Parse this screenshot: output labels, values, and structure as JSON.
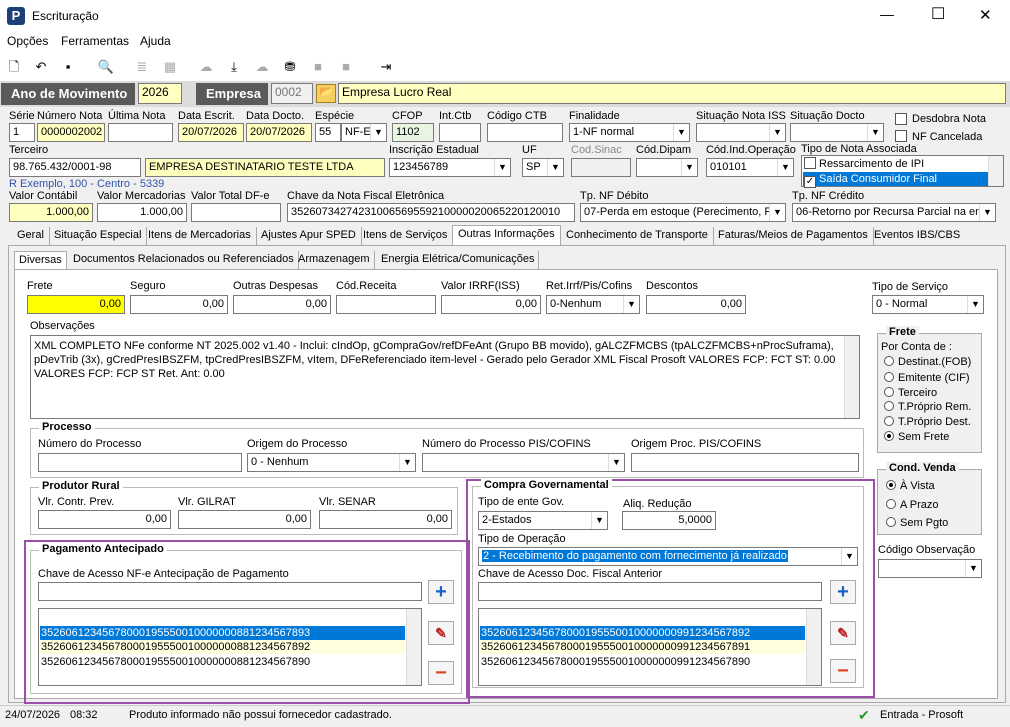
{
  "window": {
    "title": "Escrituração",
    "min": "—",
    "max": "☐",
    "close": "✕"
  },
  "menu": [
    "Opções",
    "Ferramentas",
    "Ajuda"
  ],
  "header": {
    "ano_label": "Ano de Movimento",
    "ano": "2026",
    "empresa_label": "Empresa",
    "empresa_cod": "0002",
    "empresa_nome": "Empresa Lucro Real"
  },
  "doc": {
    "serie_l": "Série",
    "serie": "1",
    "numero_l": "Número Nota",
    "numero": "0000002002",
    "ultima_l": "Última Nota",
    "ultima": "",
    "dtescr_l": "Data Escrit.",
    "dtescr": "20/07/2026",
    "dtdoc_l": "Data Docto.",
    "dtdoc": "20/07/2026",
    "especie_l": "Espécie",
    "especie_n": "55",
    "especie": "NF-E",
    "cfop_l": "CFOP",
    "cfop": "1102",
    "intctb_l": "Int.Ctb",
    "intctb": "",
    "codctb_l": "Código CTB",
    "codctb": "",
    "final_l": "Finalidade",
    "final": "1-NF normal",
    "sitiss_l": "Situação Nota ISS",
    "sitiss": "",
    "sitdoc_l": "Situação Docto",
    "sitdoc": "",
    "desdobra": "Desdobra Nota",
    "cancelada": "NF Cancelada",
    "terc_l": "Terceiro",
    "terc": "98.765.432/0001-98",
    "terc_nome": "EMPRESA DESTINATARIO TESTE LTDA",
    "terc_end": "R Exemplo, 100 - Centro - 5339",
    "ie_l": "Inscrição Estadual",
    "ie": "123456789",
    "uf_l": "UF",
    "uf": "SP",
    "sinac_l": "Cod.Sinac",
    "sinac": "",
    "dipam_l": "Cód.Dipam",
    "dipam": "",
    "indop_l": "Cód.Ind.Operação",
    "indop": "010101",
    "tipoassoc_l": "Tipo de Nota Associada",
    "assoc": [
      "Ressarcimento de IPI",
      "Saída Consumidor Final"
    ],
    "vcont_l": "Valor Contábil",
    "vcont": "1.000,00",
    "vmerc_l": "Valor Mercadorias",
    "vmerc": "1.000,00",
    "vtot_l": "Valor Total DF-e",
    "vtot": "",
    "chave_l": "Chave da Nota Fiscal Eletrônica",
    "chave": "35260734274231006569559210000020065220120010",
    "tpdeb_l": "Tp. NF Débito",
    "tpdeb": "07-Perda em estoque (Perecimento, P",
    "tpcred_l": "Tp. NF Crédito",
    "tpcred": "06-Retorno por Recursa Parcial na en"
  },
  "tabs": [
    "Geral",
    "Situação Especial",
    "Itens de Mercadorias",
    "Ajustes Apur SPED",
    "Itens de Serviços",
    "Outras Informações",
    "Conhecimento de Transporte",
    "Faturas/Meios de Pagamentos",
    "Eventos IBS/CBS"
  ],
  "subtabs": [
    "Diversas",
    "Documentos Relacionados ou Referenciados",
    "Armazenagem",
    "Energia Elétrica/Comunicações"
  ],
  "div": {
    "frete_l": "Frete",
    "frete": "0,00",
    "seguro_l": "Seguro",
    "seguro": "0,00",
    "outras_l": "Outras Despesas",
    "outras": "0,00",
    "codrec_l": "Cód.Receita",
    "codrec": "",
    "irrf_l": "Valor IRRF(ISS)",
    "irrf": "0,00",
    "retirrf_l": "Ret.Irrf/Pis/Cofins",
    "retirrf": "0-Nenhum",
    "desc_l": "Descontos",
    "desc": "0,00",
    "tiposerv_l": "Tipo de Serviço",
    "tiposerv": "0 - Normal",
    "obs_l": "Observações",
    "obs": [
      "XML COMPLETO NFe conforme NT 2025.002 v1.40 - Inclui: cIndOp, gCompraGov/refDFeAnt (Grupo BB movido), gALCZFMCBS (tpALCZFMCBS+nProcSuframa),",
      "pDevTrib (3x), gCredPresIBSZFM, tpCredPresIBSZFM, vItem, DFeReferenciado item-level - Gerado pelo Gerador XML Fiscal Prosoft VALORES FCP: FCT ST: 0.00",
      "VALORES FCP: FCP ST Ret. Ant: 0.00"
    ],
    "frete_grp": "Frete",
    "porconta": "Por Conta de :",
    "frete_opts": [
      "Destinat.(FOB)",
      "Emitente (CIF)",
      "Terceiro",
      "T.Próprio Rem.",
      "T.Próprio Dest.",
      "Sem Frete"
    ],
    "condvenda": "Cond. Venda",
    "cond_opts": [
      "À Vista",
      "A Prazo",
      "Sem Pgto"
    ],
    "codobs_l": "Código Observação",
    "codobs": "",
    "proc_t": "Processo",
    "numproc_l": "Número do Processo",
    "numproc": "",
    "origproc_l": "Origem do Processo",
    "origproc": "0 - Nenhum",
    "numpis_l": "Número do Processo PIS/COFINS",
    "numpis": "",
    "origpis_l": "Origem Proc. PIS/COFINS",
    "origpis": "",
    "prod_t": "Produtor Rural",
    "contr_l": "Vlr. Contr. Prev.",
    "contr": "0,00",
    "gilrat_l": "Vlr. GILRAT",
    "gilrat": "0,00",
    "senar_l": "Vlr. SENAR",
    "senar": "0,00",
    "pag_t": "Pagamento Antecipado",
    "pagchave_l": "Chave de Acesso NF-e Antecipação de Pagamento",
    "pagchave": "",
    "pag_list": [
      "35260612345678000195550010000000881234567893",
      "35260612345678000195550010000000881234567892",
      "35260612345678000195550010000000881234567890"
    ],
    "cg_t": "Compra Governamental",
    "enteg_l": "Tipo de ente Gov.",
    "enteg": "2-Estados",
    "aliq_l": "Aliq. Redução",
    "aliq": "5,0000",
    "tpop_l": "Tipo de Operação",
    "tpop": "2 - Recebimento do pagamento com fornecimento já realizado",
    "cgchave_l": "Chave de Acesso Doc. Fiscal Anterior",
    "cgchave": "",
    "cg_list": [
      "35260612345678000195550010000000991234567892",
      "35260612345678000195550010000000991234567891",
      "35260612345678000195550010000000991234567890"
    ]
  },
  "status": {
    "date": "24/07/2026",
    "time": "08:32",
    "msg": "Produto informado não possui fornecedor cadastrado.",
    "right": "Entrada - Prosoft"
  }
}
